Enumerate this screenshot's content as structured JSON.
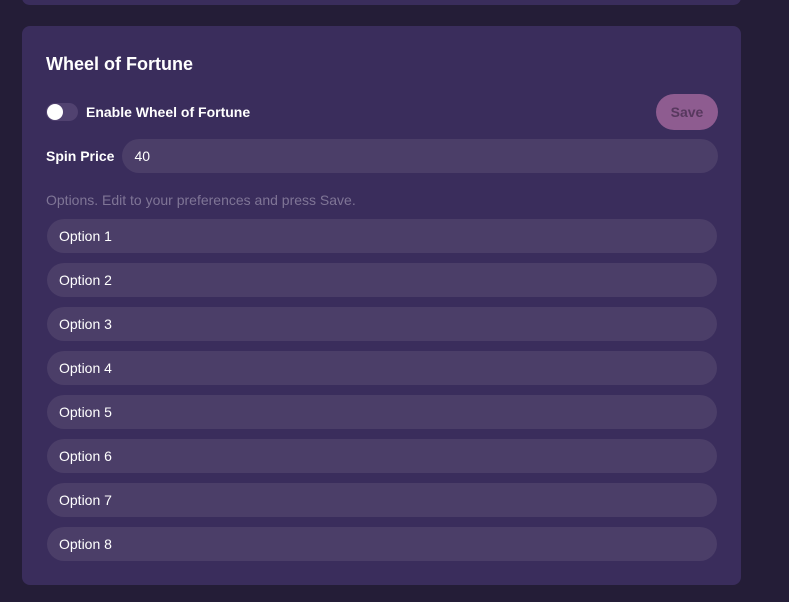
{
  "card": {
    "title": "Wheel of Fortune"
  },
  "toggle": {
    "label": "Enable Wheel of Fortune",
    "enabled": false
  },
  "save_label": "Save",
  "spin_price": {
    "label": "Spin Price",
    "value": "40"
  },
  "hint": "Options. Edit to your preferences and press Save.",
  "options": [
    "Option 1",
    "Option 2",
    "Option 3",
    "Option 4",
    "Option 5",
    "Option 6",
    "Option 7",
    "Option 8"
  ],
  "colors": {
    "background": "#241d37",
    "card": "#3a2d5c",
    "field": "#4b3e68",
    "accent": "#8e5c90"
  }
}
